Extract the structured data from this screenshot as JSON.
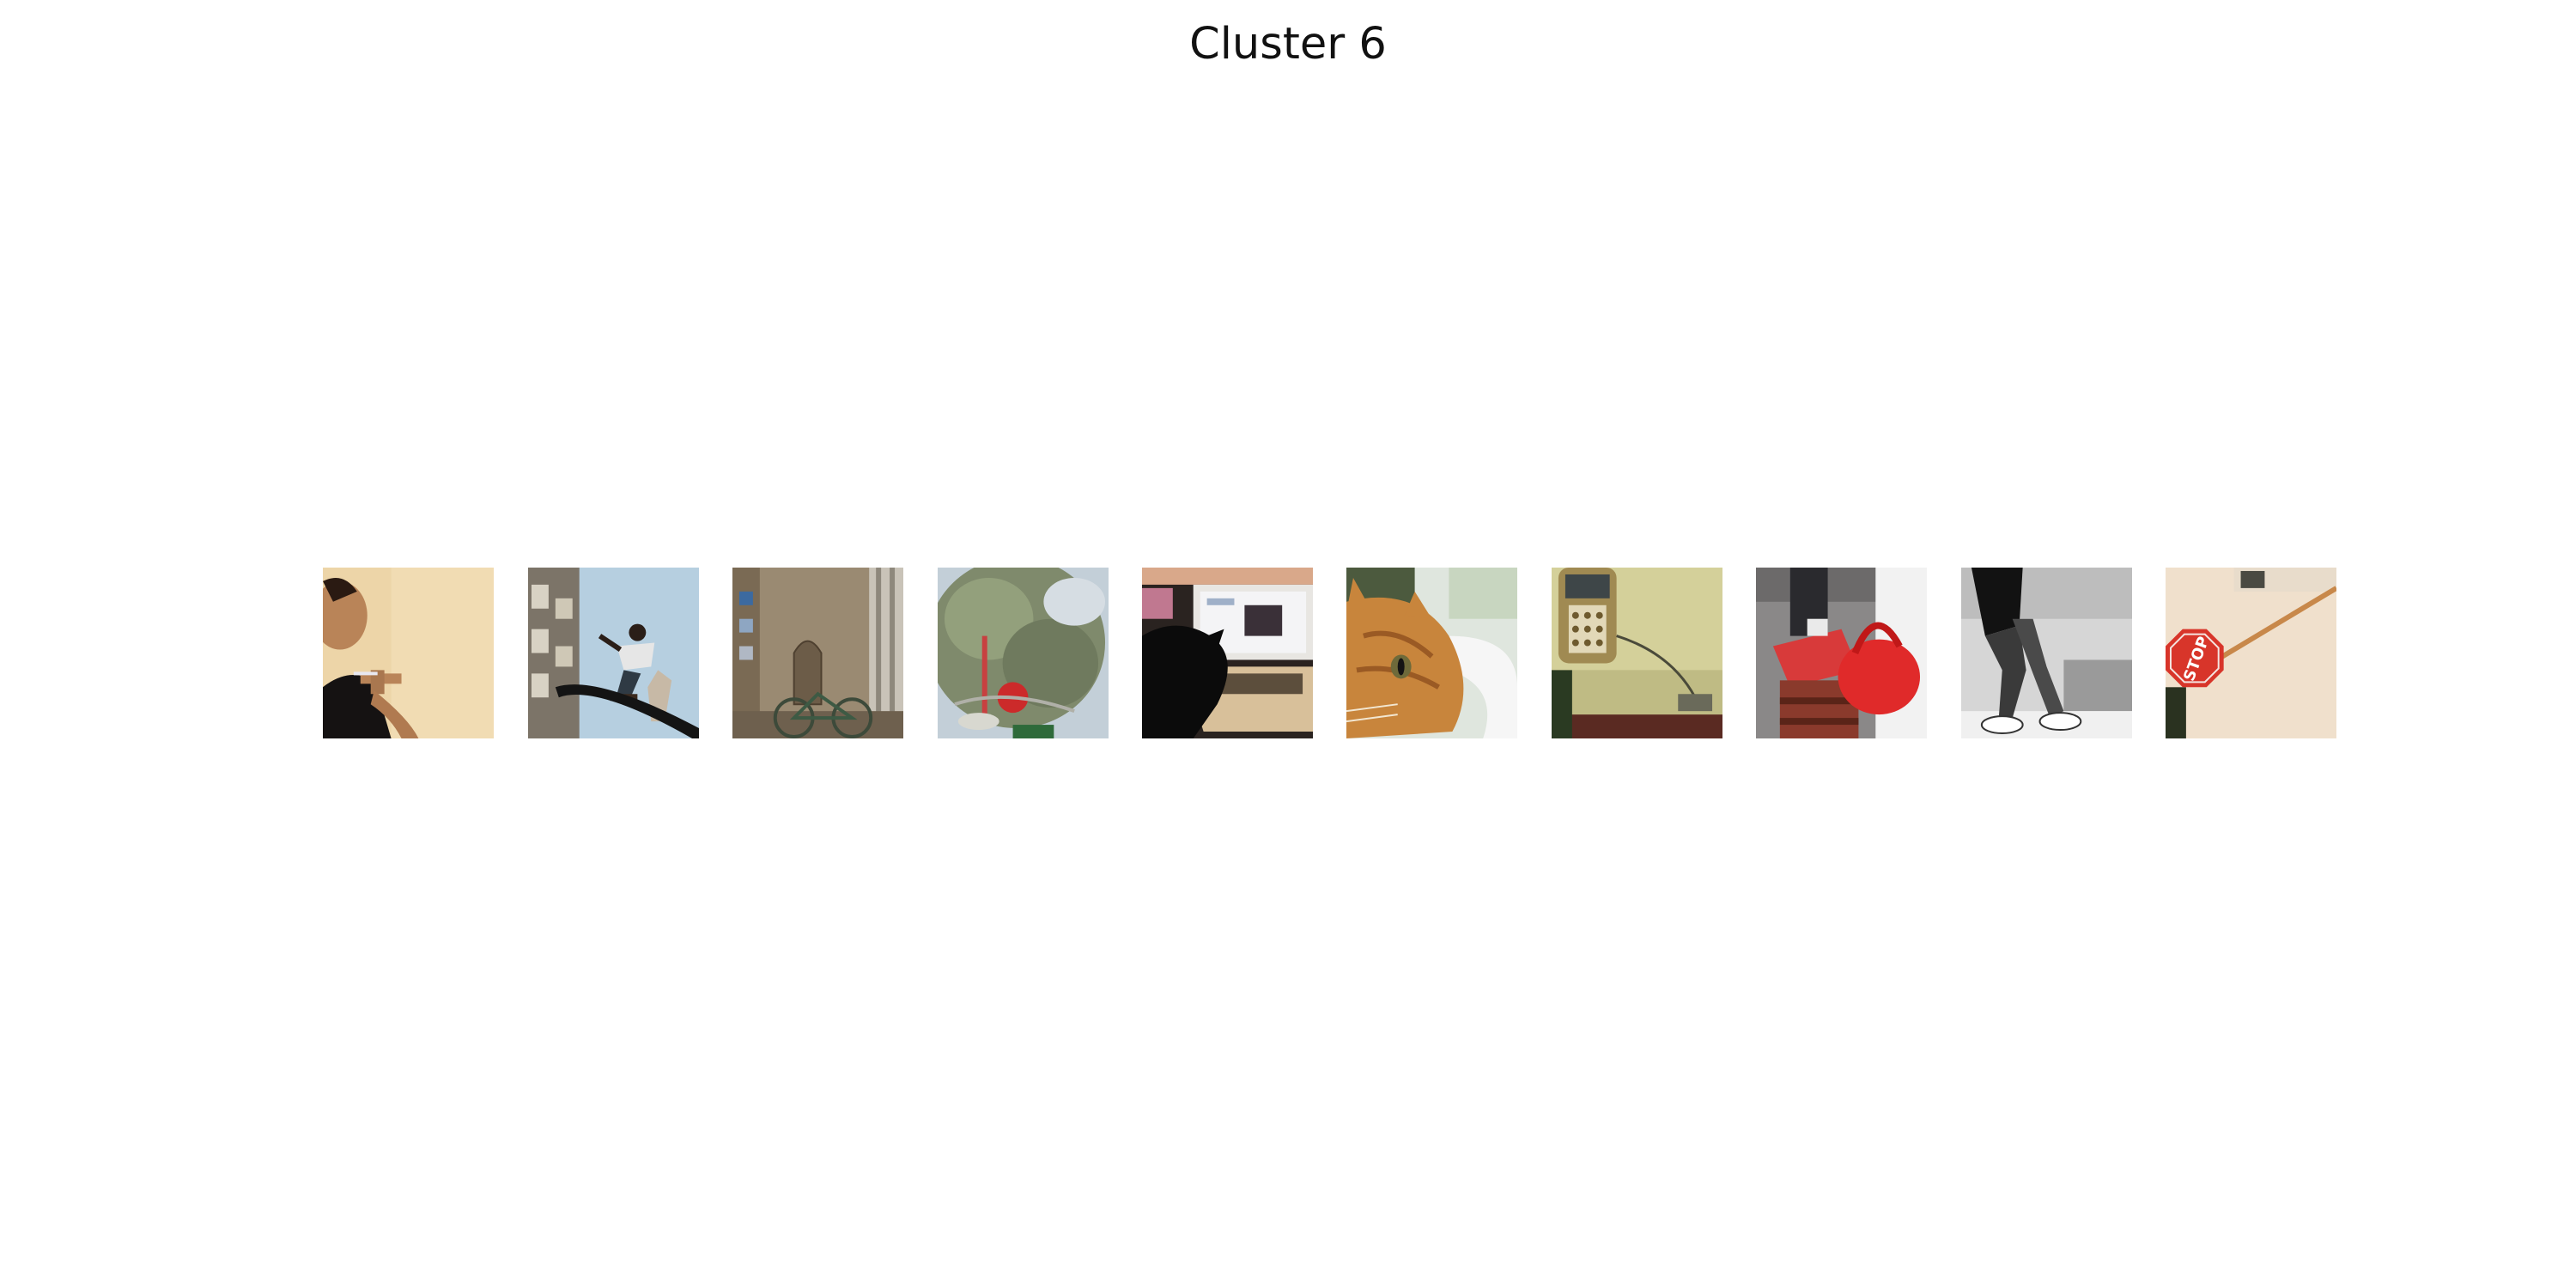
{
  "figure": {
    "title": "Cluster 6"
  },
  "thumbnails": [
    {
      "subject": "person-toothbrush"
    },
    {
      "subject": "skateboarder-jump"
    },
    {
      "subject": "bicycle-stone-wall"
    },
    {
      "subject": "tree-red-object"
    },
    {
      "subject": "cat-laptop"
    },
    {
      "subject": "orange-cat-sink"
    },
    {
      "subject": "phone-on-wall"
    },
    {
      "subject": "red-handbag"
    },
    {
      "subject": "legs-sneakers-bw"
    },
    {
      "subject": "stop-sign"
    }
  ],
  "colors": {
    "background": "#ffffff",
    "title": "#111111"
  }
}
